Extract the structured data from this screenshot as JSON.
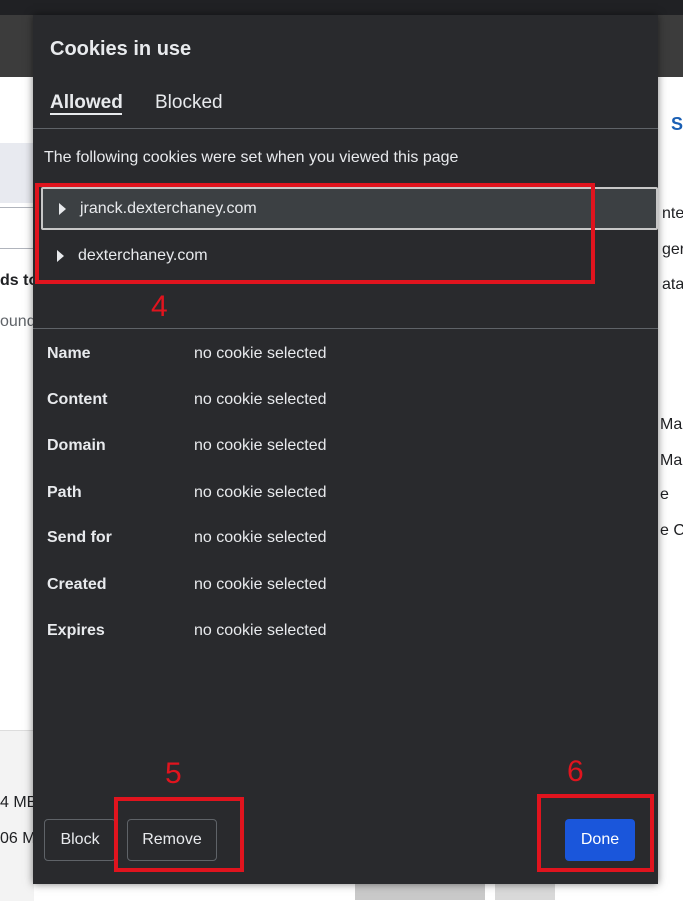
{
  "background": {
    "left_texts": [
      "ds to",
      "ound",
      "4 MB",
      "06 M"
    ],
    "right_texts": [
      "S",
      "nter",
      "ger",
      "ata",
      "Ma",
      "Mai",
      "e",
      "e Cr"
    ]
  },
  "dialog": {
    "title": "Cookies in use",
    "tabs": [
      {
        "label": "Allowed",
        "active": true
      },
      {
        "label": "Blocked",
        "active": false
      }
    ],
    "description": "The following cookies were set when you viewed this page",
    "tree": [
      {
        "label": "jranck.dexterchaney.com",
        "selected": true
      },
      {
        "label": "dexterchaney.com",
        "selected": false
      }
    ],
    "details": [
      {
        "label": "Name",
        "value": "no cookie selected"
      },
      {
        "label": "Content",
        "value": "no cookie selected"
      },
      {
        "label": "Domain",
        "value": "no cookie selected"
      },
      {
        "label": "Path",
        "value": "no cookie selected"
      },
      {
        "label": "Send for",
        "value": "no cookie selected"
      },
      {
        "label": "Created",
        "value": "no cookie selected"
      },
      {
        "label": "Expires",
        "value": "no cookie selected"
      }
    ],
    "buttons": {
      "block": "Block",
      "remove": "Remove",
      "done": "Done"
    }
  },
  "annotations": {
    "tree_marker": "4",
    "remove_marker": "5",
    "done_marker": "6",
    "color": "#e0141e"
  }
}
